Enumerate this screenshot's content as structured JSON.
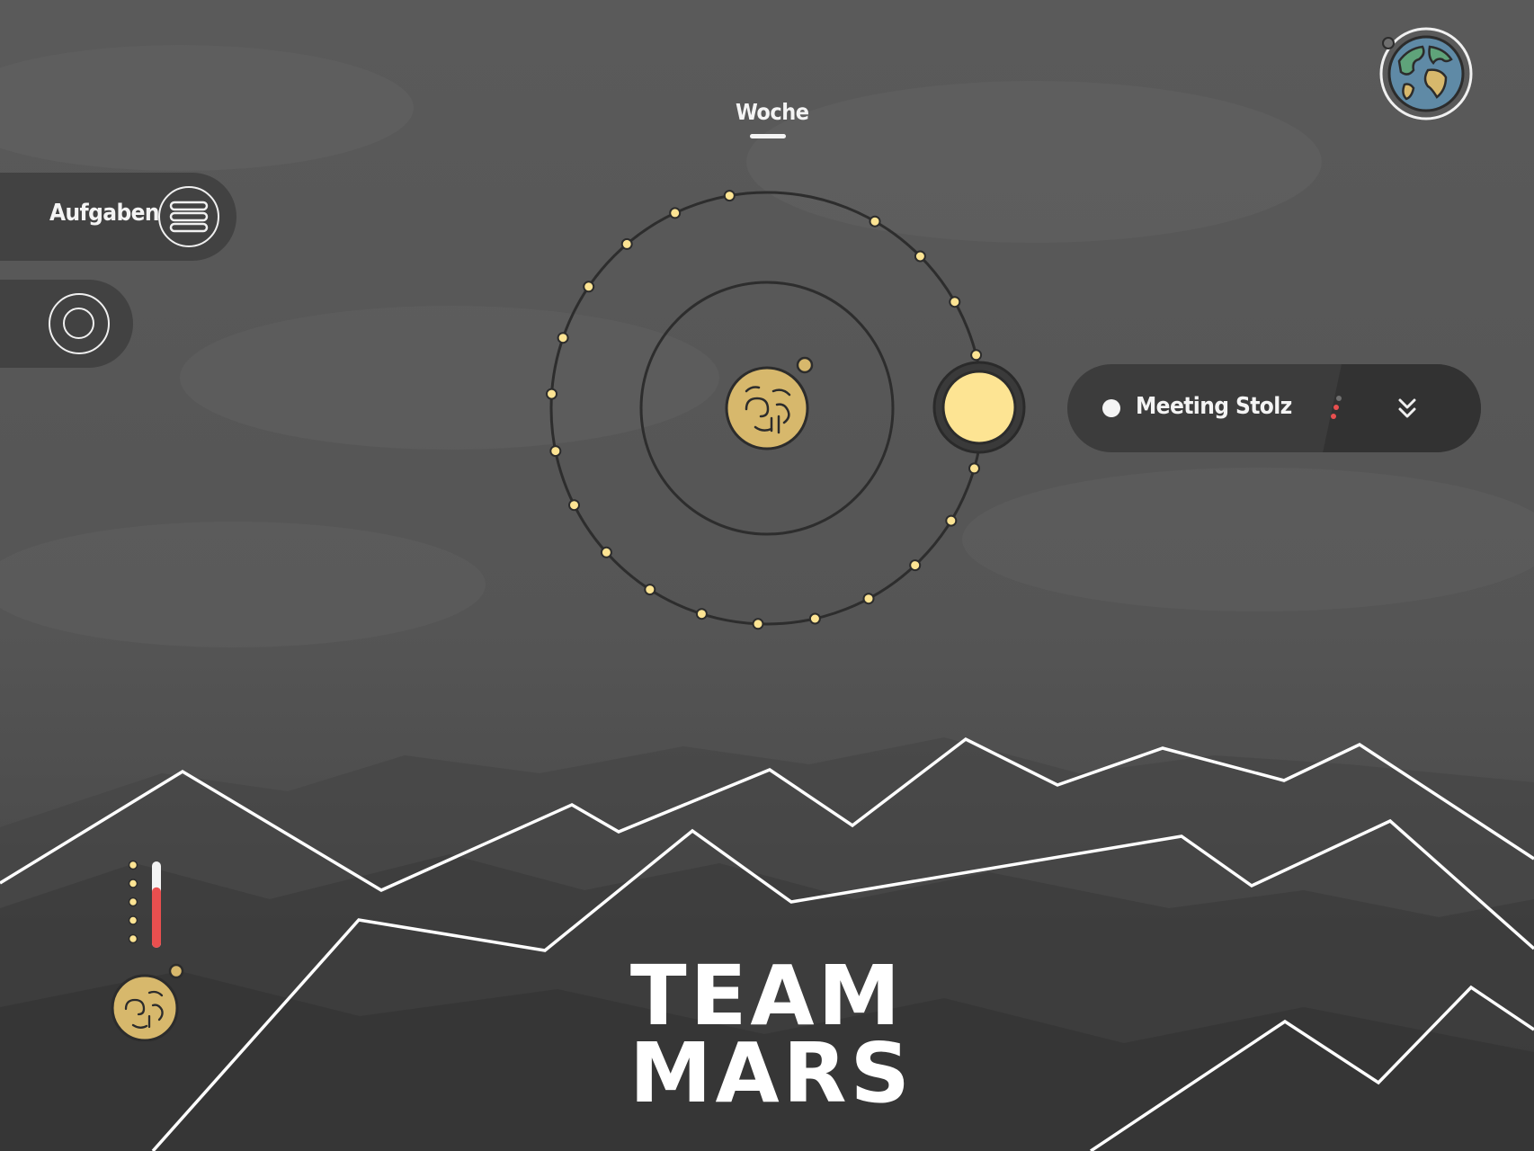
{
  "header": {
    "active_view": "Woche"
  },
  "sidebar": {
    "tasks_label": "Aufgaben",
    "tasks_icon": "list-icon",
    "ring_icon": "target-ring-icon"
  },
  "event": {
    "title": "Meeting Stolz",
    "expand_icon": "double-chevron-down-icon"
  },
  "orbit": {
    "day_markers": 22,
    "sun_color": "#fde493",
    "planet_color": "#d7b86c"
  },
  "team": {
    "line1": "TEAM",
    "line2": "MARS"
  },
  "progress": {
    "level": 0.7,
    "bar_color": "#e94f4f",
    "dots": 5
  },
  "colors": {
    "background": "#575757",
    "pill": "#424242",
    "accent_yellow": "#fde493",
    "text": "#f4f4f4"
  }
}
